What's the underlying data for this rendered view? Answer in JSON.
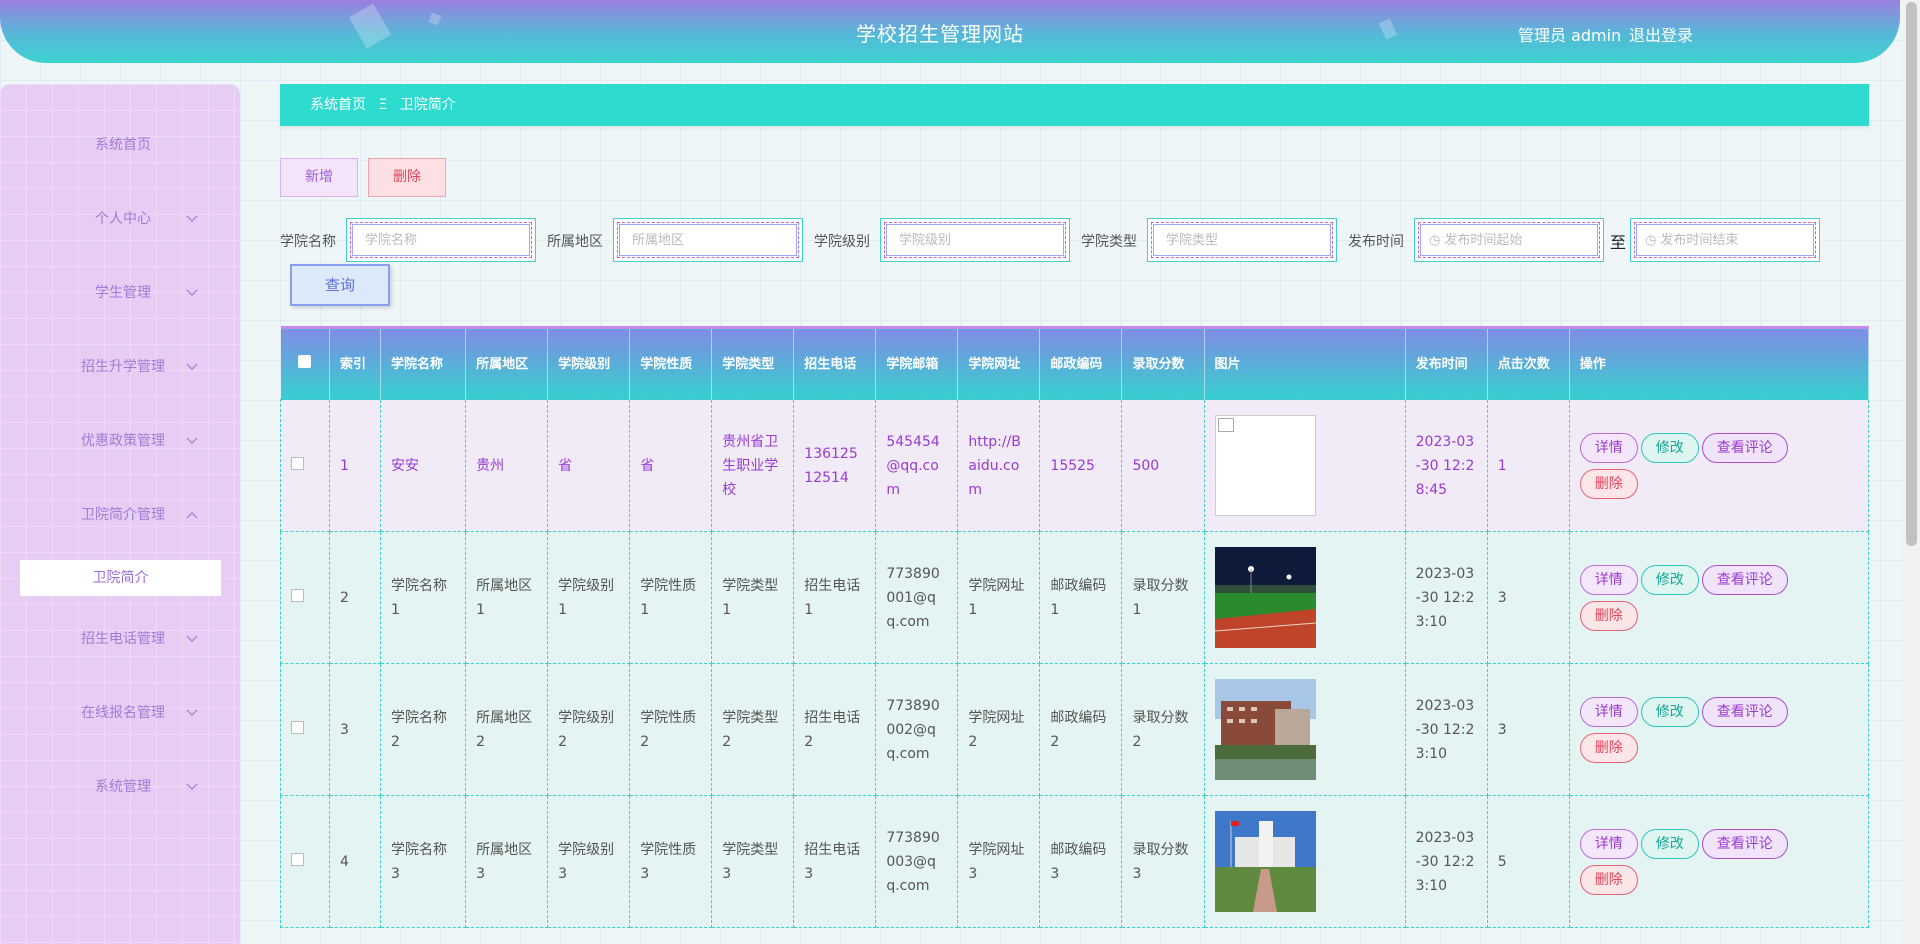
{
  "header": {
    "title": "学校招生管理网站",
    "user": "管理员 admin",
    "logout": "退出登录"
  },
  "sidebar": {
    "items": [
      {
        "label": "系统首页",
        "arrow": "none"
      },
      {
        "label": "个人中心",
        "arrow": "chevron-down-icon"
      },
      {
        "label": "学生管理",
        "arrow": "chevron-down-icon"
      },
      {
        "label": "招生升学管理",
        "arrow": "chevron-down-icon"
      },
      {
        "label": "优惠政策管理",
        "arrow": "chevron-down-icon"
      },
      {
        "label": "卫院简介管理",
        "arrow": "chevron-up-icon"
      },
      {
        "label": "招生电话管理",
        "arrow": "chevron-down-icon"
      },
      {
        "label": "在线报名管理",
        "arrow": "chevron-down-icon"
      },
      {
        "label": "系统管理",
        "arrow": "chevron-down-icon"
      }
    ],
    "active_sub": "卫院简介"
  },
  "breadcrumb": {
    "home": "系统首页",
    "sep": "Ξ",
    "current": "卫院简介"
  },
  "actions": {
    "add": "新增",
    "delete": "删除"
  },
  "search": {
    "fields": [
      {
        "label": "学院名称",
        "placeholder": "学院名称"
      },
      {
        "label": "所属地区",
        "placeholder": "所属地区"
      },
      {
        "label": "学院级别",
        "placeholder": "学院级别"
      },
      {
        "label": "学院类型",
        "placeholder": "学院类型"
      },
      {
        "label": "发布时间",
        "placeholder": "发布时间起始"
      }
    ],
    "to": "至",
    "end_placeholder": "发布时间结束",
    "query": "查询"
  },
  "table": {
    "headers": [
      "",
      "索引",
      "学院名称",
      "所属地区",
      "学院级别",
      "学院性质",
      "学院类型",
      "招生电话",
      "学院邮箱",
      "学院网址",
      "邮政编码",
      "录取分数",
      "图片",
      "发布时间",
      "点击次数",
      "操作"
    ],
    "rows": [
      {
        "index": "1",
        "name": "安安",
        "region": "贵州",
        "level": "省",
        "nature": "省",
        "type": "贵州省卫生职业学校",
        "phone": "13612512514",
        "email": "545454@qq.com",
        "url": "http://Baidu.com",
        "zip": "15525",
        "score": "500",
        "image": "broken",
        "time": "2023-03-30 12:28:45",
        "clicks": "1"
      },
      {
        "index": "2",
        "name": "学院名称1",
        "region": "所属地区1",
        "level": "学院级别1",
        "nature": "学院性质1",
        "type": "学院类型1",
        "phone": "招生电话1",
        "email": "773890001@qq.com",
        "url": "学院网址1",
        "zip": "邮政编码1",
        "score": "录取分数1",
        "image": "stadium",
        "time": "2023-03-30 12:23:10",
        "clicks": "3"
      },
      {
        "index": "3",
        "name": "学院名称2",
        "region": "所属地区2",
        "level": "学院级别2",
        "nature": "学院性质2",
        "type": "学院类型2",
        "phone": "招生电话2",
        "email": "773890002@qq.com",
        "url": "学院网址2",
        "zip": "邮政编码2",
        "score": "录取分数2",
        "image": "campus-building",
        "time": "2023-03-30 12:23:10",
        "clicks": "3"
      },
      {
        "index": "4",
        "name": "学院名称3",
        "region": "所属地区3",
        "level": "学院级别3",
        "nature": "学院性质3",
        "type": "学院类型3",
        "phone": "招生电话3",
        "email": "773890003@qq.com",
        "url": "学院网址3",
        "zip": "邮政编码3",
        "score": "录取分数3",
        "image": "campus-square",
        "time": "2023-03-30 12:23:10",
        "clicks": "5"
      }
    ],
    "ops": {
      "detail": "详情",
      "edit": "修改",
      "comment": "查看评论",
      "delete": "删除"
    }
  },
  "colors": {
    "accent": "#2ddbcf",
    "purple": "#9a3bd0",
    "danger": "#e0455a"
  }
}
